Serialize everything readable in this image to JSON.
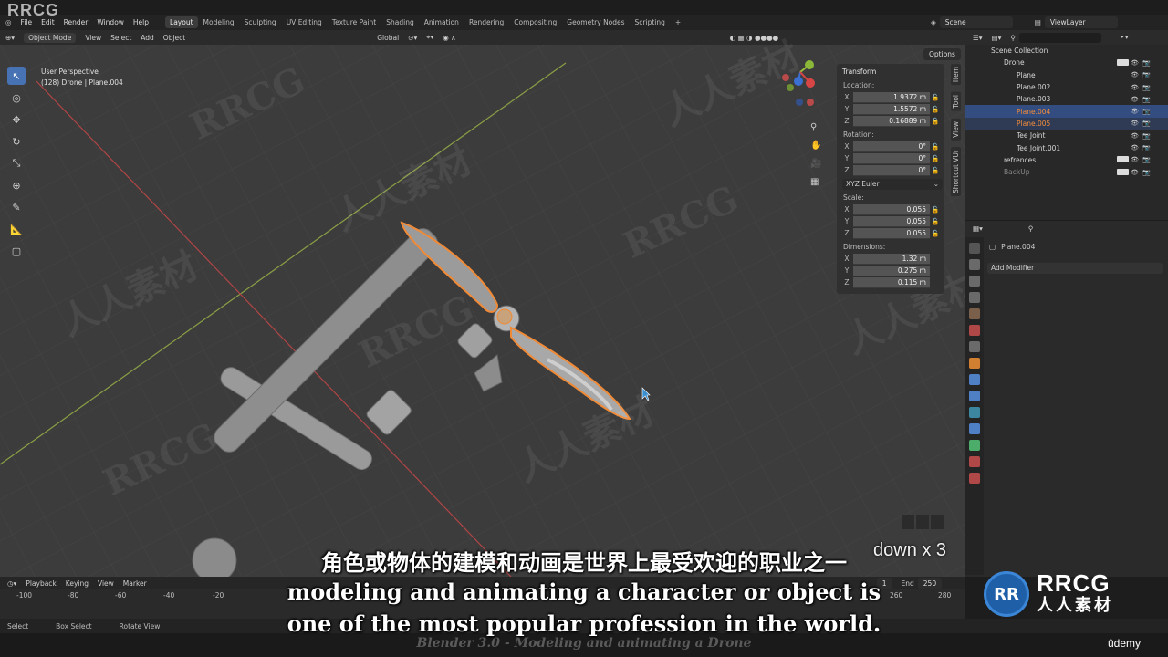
{
  "app": {
    "menu": [
      "File",
      "Edit",
      "Render",
      "Window",
      "Help"
    ],
    "workspace_tabs": [
      "Layout",
      "Modeling",
      "Sculpting",
      "UV Editing",
      "Texture Paint",
      "Shading",
      "Animation",
      "Rendering",
      "Compositing",
      "Geometry Nodes",
      "Scripting"
    ],
    "active_tab": "Layout",
    "add_tab": "+",
    "scene": "Scene",
    "view_layer": "ViewLayer"
  },
  "header": {
    "mode": "Object Mode",
    "menus": [
      "View",
      "Select",
      "Add",
      "Object"
    ],
    "orientation": "Global",
    "options": "Options"
  },
  "viewport": {
    "perspective": "User Perspective",
    "object_info": "(128) Drone | Plane.004",
    "wheel_overlay": "down x 3"
  },
  "transform": {
    "title": "Transform",
    "location_label": "Location:",
    "location": {
      "x": "1.9372 m",
      "y": "1.5572 m",
      "z": "0.16889 m"
    },
    "rotation_label": "Rotation:",
    "rotation": {
      "x": "0°",
      "y": "0°",
      "z": "0°"
    },
    "rotation_mode": "XYZ Euler",
    "scale_label": "Scale:",
    "scale": {
      "x": "0.055",
      "y": "0.055",
      "z": "0.055"
    },
    "dimensions_label": "Dimensions:",
    "dimensions": {
      "x": "1.32 m",
      "y": "0.275 m",
      "z": "0.115 m"
    }
  },
  "side_tabs": [
    "Item",
    "Tool",
    "View",
    "Shortcut VUr"
  ],
  "outliner": {
    "root": "Scene Collection",
    "items": [
      {
        "name": "Drone",
        "indent": 1
      },
      {
        "name": "Plane",
        "indent": 2
      },
      {
        "name": "Plane.002",
        "indent": 2
      },
      {
        "name": "Plane.003",
        "indent": 2
      },
      {
        "name": "Plane.004",
        "indent": 2
      },
      {
        "name": "Plane.005",
        "indent": 2
      },
      {
        "name": "Tee Joint",
        "indent": 2
      },
      {
        "name": "Tee Joint.001",
        "indent": 2
      },
      {
        "name": "refrences",
        "indent": 1
      },
      {
        "name": "BackUp",
        "indent": 1
      }
    ]
  },
  "properties": {
    "object": "Plane.004",
    "add_modifier": "Add Modifier"
  },
  "timeline": {
    "menus": [
      "Playback",
      "Keying",
      "View",
      "Marker"
    ],
    "start": "1",
    "end_label": "End",
    "end": "250",
    "ticks": [
      "-100",
      "-80",
      "-60",
      "-40",
      "-20",
      "260",
      "280"
    ]
  },
  "status": [
    "Select",
    "Box Select",
    "Rotate View"
  ],
  "subtitles": {
    "cn": "角色或物体的建模和动画是世界上最受欢迎的职业之一",
    "en1": "modeling and animating a character or object is",
    "en2": "one of the most popular profession in the world."
  },
  "watermark": {
    "top_left": "RRCG",
    "text_a": "RRCG",
    "text_b": "人人素材",
    "logo_mark": "RR",
    "logo_1": "RRCG",
    "logo_2": "人人素材"
  },
  "course_title": "Blender 3.0 - Modeling and animating a Drone",
  "udemy": "ûdemy",
  "colors": {
    "accent": "#4772b3",
    "selection": "#f28c3a",
    "x_axis": "#d44a4a",
    "y_axis": "#8fb34a"
  }
}
